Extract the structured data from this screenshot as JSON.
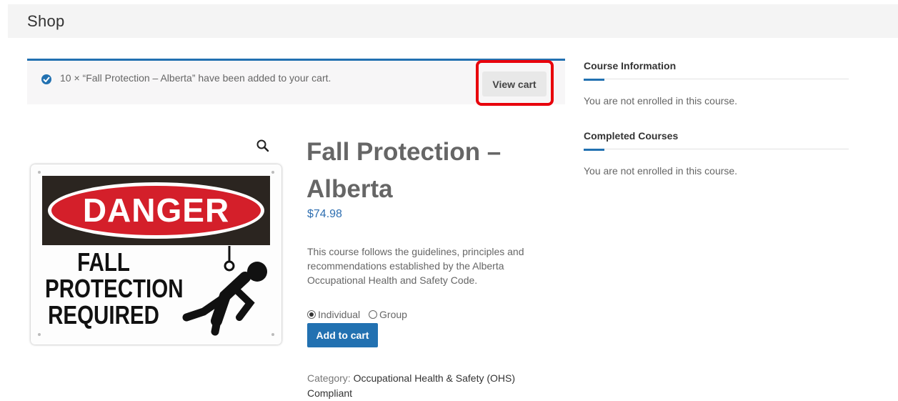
{
  "page": {
    "title": "Shop"
  },
  "notice": {
    "message": "10 × “Fall Protection – Alberta” have been added to your cart.",
    "view_cart_label": "View cart"
  },
  "product": {
    "image": {
      "danger": "DANGER",
      "line1": "FALL",
      "line2": "PROTECTION",
      "line3": "REQUIRED"
    },
    "title": "Fall Protection – Alberta",
    "price": "$74.98",
    "description": "This course follows the guidelines, principles and recommendations established by the Alberta Occupational Health and Safety Code.",
    "options": [
      {
        "label": "Individual",
        "selected": true
      },
      {
        "label": "Group",
        "selected": false
      }
    ],
    "add_to_cart_label": "Add to cart",
    "category_label": "Category:",
    "category_value": "Occupational Health & Safety (OHS) Compliant"
  },
  "sidebar": {
    "widgets": [
      {
        "title": "Course Information",
        "text": "You are not enrolled in this course."
      },
      {
        "title": "Completed Courses",
        "text": "You are not enrolled in this course."
      }
    ]
  },
  "colors": {
    "accent": "#2271b1",
    "highlight": "#e8000b",
    "danger_red": "#d41f2a"
  },
  "icons": [
    "check-circle-icon",
    "zoom-icon"
  ]
}
